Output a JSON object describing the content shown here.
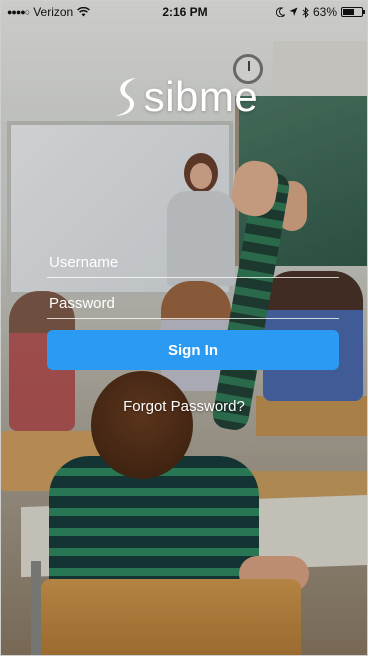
{
  "status_bar": {
    "carrier": "Verizon",
    "time": "2:16 PM",
    "battery_percent": "63%",
    "battery_level": 0.63,
    "icons": [
      "signal-dots-icon",
      "wifi-icon",
      "moon-icon",
      "location-arrow-icon",
      "bluetooth-icon",
      "battery-icon"
    ]
  },
  "logo": {
    "text": "sibme",
    "mark_icon": "leaf-s-icon"
  },
  "login": {
    "username_placeholder": "Username",
    "username_value": "",
    "password_placeholder": "Password",
    "password_value": "",
    "signin_label": "Sign In",
    "forgot_label": "Forgot Password?"
  },
  "colors": {
    "primary_button": "#2b9af3",
    "text_on_image": "#ffffff"
  }
}
